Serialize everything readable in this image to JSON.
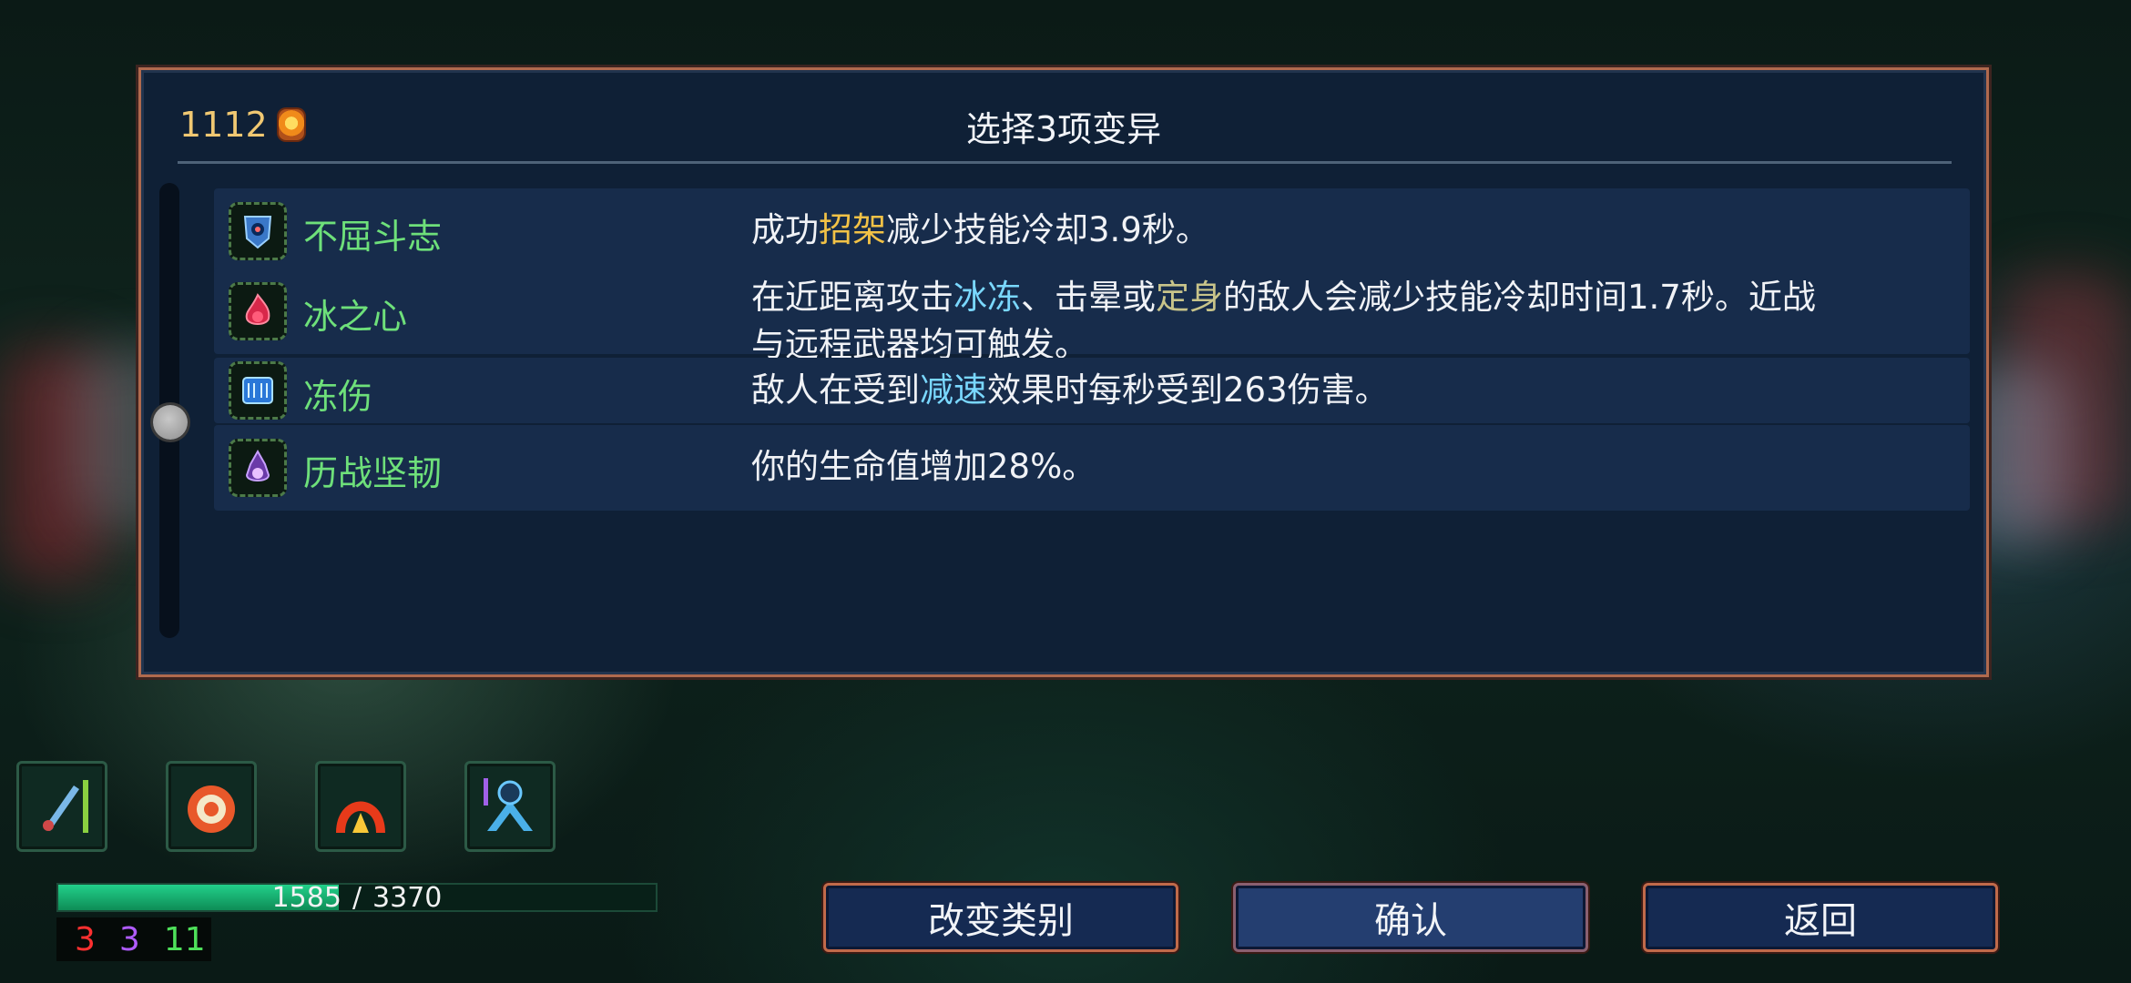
{
  "dialog": {
    "title": "选择3项变异",
    "gold": "1112"
  },
  "mutations": [
    {
      "name": "不屈斗志",
      "desc": [
        {
          "t": "成功",
          "c": "plain"
        },
        {
          "t": "招架",
          "c": "gold"
        },
        {
          "t": "减少技能冷却3.9秒。",
          "c": "plain"
        }
      ]
    },
    {
      "name": "冰之心",
      "desc": [
        {
          "t": "在近距离攻击",
          "c": "plain"
        },
        {
          "t": "冰冻",
          "c": "blue"
        },
        {
          "t": "、击晕或",
          "c": "plain"
        },
        {
          "t": "定身",
          "c": "olive"
        },
        {
          "t": "的敌人会减少技能冷却时间1.7秒。近战与远程武器均可触发。",
          "c": "plain"
        }
      ]
    },
    {
      "name": "冻伤",
      "desc": [
        {
          "t": "敌人在受到",
          "c": "plain"
        },
        {
          "t": "减速",
          "c": "blue"
        },
        {
          "t": "效果时每秒受到263伤害。",
          "c": "plain"
        }
      ]
    },
    {
      "name": "历战坚韧",
      "desc": [
        {
          "t": "你的生命值增加28%。",
          "c": "plain"
        }
      ]
    }
  ],
  "health": {
    "current": "1585",
    "max": "3370",
    "separator": "/",
    "fraction": 0.47
  },
  "stats": {
    "brutality": "3",
    "tactics": "3",
    "survival": "11"
  },
  "buttons": {
    "change_category": "改变类别",
    "confirm": "确认",
    "back": "返回"
  },
  "colors": {
    "gold": "#f2c246",
    "blue": "#7ad8ff",
    "olive": "#c8c48a",
    "name_green": "#6ee07a",
    "frame": "#b06a4e"
  }
}
